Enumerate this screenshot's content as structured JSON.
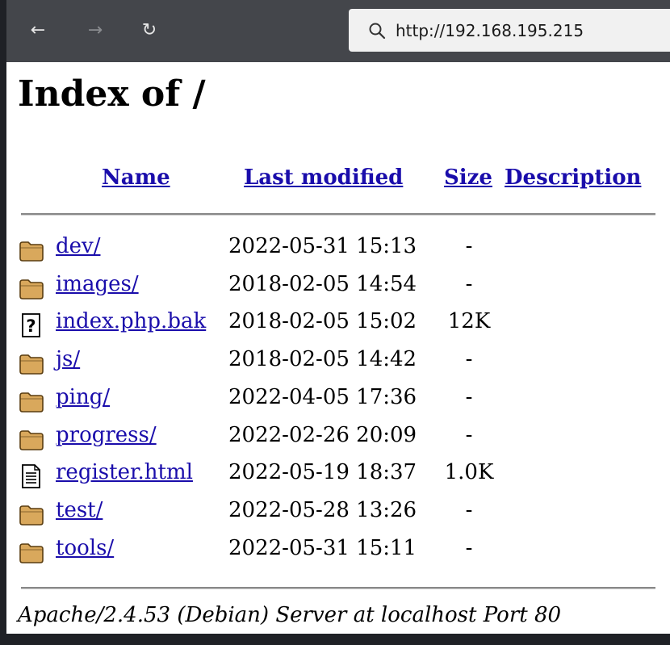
{
  "browser": {
    "back_icon": "←",
    "forward_icon": "→",
    "reload_icon": "↻",
    "url": "http://192.168.195.215"
  },
  "page": {
    "title": "Index of /",
    "headers": {
      "name": "Name",
      "modified": "Last modified",
      "size": "Size",
      "description": "Description"
    },
    "entries": [
      {
        "icon": "folder-icon",
        "name": "dev/",
        "modified": "2022-05-31 15:13",
        "size": "-"
      },
      {
        "icon": "folder-icon",
        "name": "images/",
        "modified": "2018-02-05 14:54",
        "size": "-"
      },
      {
        "icon": "unknown-file-icon",
        "name": "index.php.bak",
        "modified": "2018-02-05 15:02",
        "size": "12K"
      },
      {
        "icon": "folder-icon",
        "name": "js/",
        "modified": "2018-02-05 14:42",
        "size": "-"
      },
      {
        "icon": "folder-icon",
        "name": "ping/",
        "modified": "2022-04-05 17:36",
        "size": "-"
      },
      {
        "icon": "folder-icon",
        "name": "progress/",
        "modified": "2022-02-26 20:09",
        "size": "-"
      },
      {
        "icon": "text-file-icon",
        "name": "register.html",
        "modified": "2022-05-19 18:37",
        "size": "1.0K"
      },
      {
        "icon": "folder-icon",
        "name": "test/",
        "modified": "2022-05-28 13:26",
        "size": "-"
      },
      {
        "icon": "folder-icon",
        "name": "tools/",
        "modified": "2022-05-31 15:11",
        "size": "-"
      }
    ],
    "footer": "Apache/2.4.53 (Debian) Server at localhost Port 80"
  }
}
